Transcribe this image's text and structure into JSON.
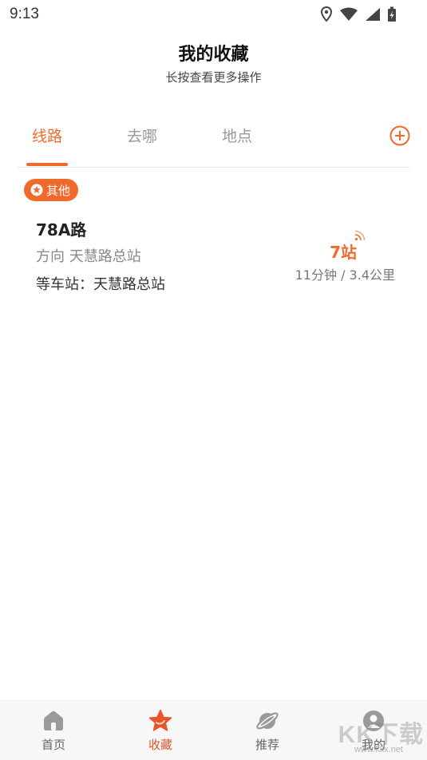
{
  "status_bar": {
    "time": "9:13"
  },
  "header": {
    "title": "我的收藏",
    "subtitle": "长按查看更多操作"
  },
  "tabs": [
    {
      "label": "线路",
      "active": true
    },
    {
      "label": "去哪",
      "active": false
    },
    {
      "label": "地点",
      "active": false
    }
  ],
  "group": {
    "badge_label": "其他"
  },
  "routes": [
    {
      "name": "78A路",
      "direction": "方向 天慧路总站",
      "stop": "等车站：天慧路总站",
      "stops_away": "7站",
      "eta": "11分钟 / 3.4公里"
    }
  ],
  "bottom_nav": [
    {
      "label": "首页",
      "icon": "home-icon",
      "active": false
    },
    {
      "label": "收藏",
      "icon": "star-icon",
      "active": true
    },
    {
      "label": "推荐",
      "icon": "planet-icon",
      "active": false
    },
    {
      "label": "我的",
      "icon": "profile-icon",
      "active": false
    }
  ],
  "watermark": {
    "text": "KK下载",
    "url": "www.kkx.net"
  },
  "colors": {
    "accent": "#f06a2c",
    "nav_active": "#e8542c"
  }
}
